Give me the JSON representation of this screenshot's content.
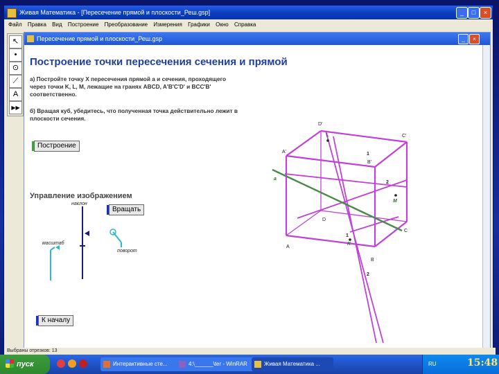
{
  "window": {
    "title": "Живая Математика - [Пересечение прямой и плоскости_Реш.gsp]",
    "buttons": [
      "_",
      "□",
      "×"
    ]
  },
  "menu": [
    "Файл",
    "Правка",
    "Вид",
    "Построение",
    "Преобразование",
    "Измерения",
    "Графики",
    "Окно",
    "Справка"
  ],
  "toolbox": [
    {
      "icon": "arrow-select-icon",
      "glyph": "↖"
    },
    {
      "icon": "point-tool-icon",
      "glyph": "•"
    },
    {
      "icon": "compass-tool-icon",
      "glyph": "⊙"
    },
    {
      "icon": "segment-tool-icon",
      "glyph": "⟋"
    },
    {
      "icon": "text-tool-icon",
      "glyph": "A"
    },
    {
      "icon": "custom-tool-icon",
      "glyph": "▶▶"
    }
  ],
  "document": {
    "title": "Пересечение прямой и плоскости_Реш.gsp",
    "heading": "Построение точки пересечения сечения и прямой",
    "task_a": "а)  Постройте точку X пересечения прямой a и сечения, проходящего через точки K, L, M, лежащие на  гранях ABCD, A'B'C'D' и BCC'B' соответственно.",
    "task_b": "б)  Вращая куб, убедитесь, что полученная точка действительно лежит в плоскости сечения.",
    "btn_construct": "Построение",
    "section_title": "Управление изображением",
    "label_tilt": "наклон",
    "label_scale": "масштаб",
    "label_rotate": "поворот",
    "btn_rotate": "Вращать",
    "btn_reset": "К началу"
  },
  "geometry_labels": {
    "D1": "D'",
    "L": "L",
    "C1": "C'",
    "A1": "A'",
    "B1": "B'",
    "a": "a",
    "n1_top": "1",
    "n2_right": "2",
    "M": "M",
    "D": "D",
    "C": "C",
    "n1_mid": "1",
    "K": "K",
    "A": "A",
    "B": "B",
    "n2_bot": "2"
  },
  "status": "Выбраны отрезков: 13",
  "taskbar": {
    "start": "пуск",
    "tasks": [
      "Интерактивные сте...",
      "4:\\______\\ter - WinRAR",
      "Живая Математика ..."
    ],
    "lang": "RU",
    "clock": "15:48"
  },
  "colors": {
    "cube": "#c040d8",
    "line_a": "#4a8a4a",
    "heading": "#1f3f99",
    "control": "#1a1a80",
    "cyan": "#30b8c8"
  }
}
